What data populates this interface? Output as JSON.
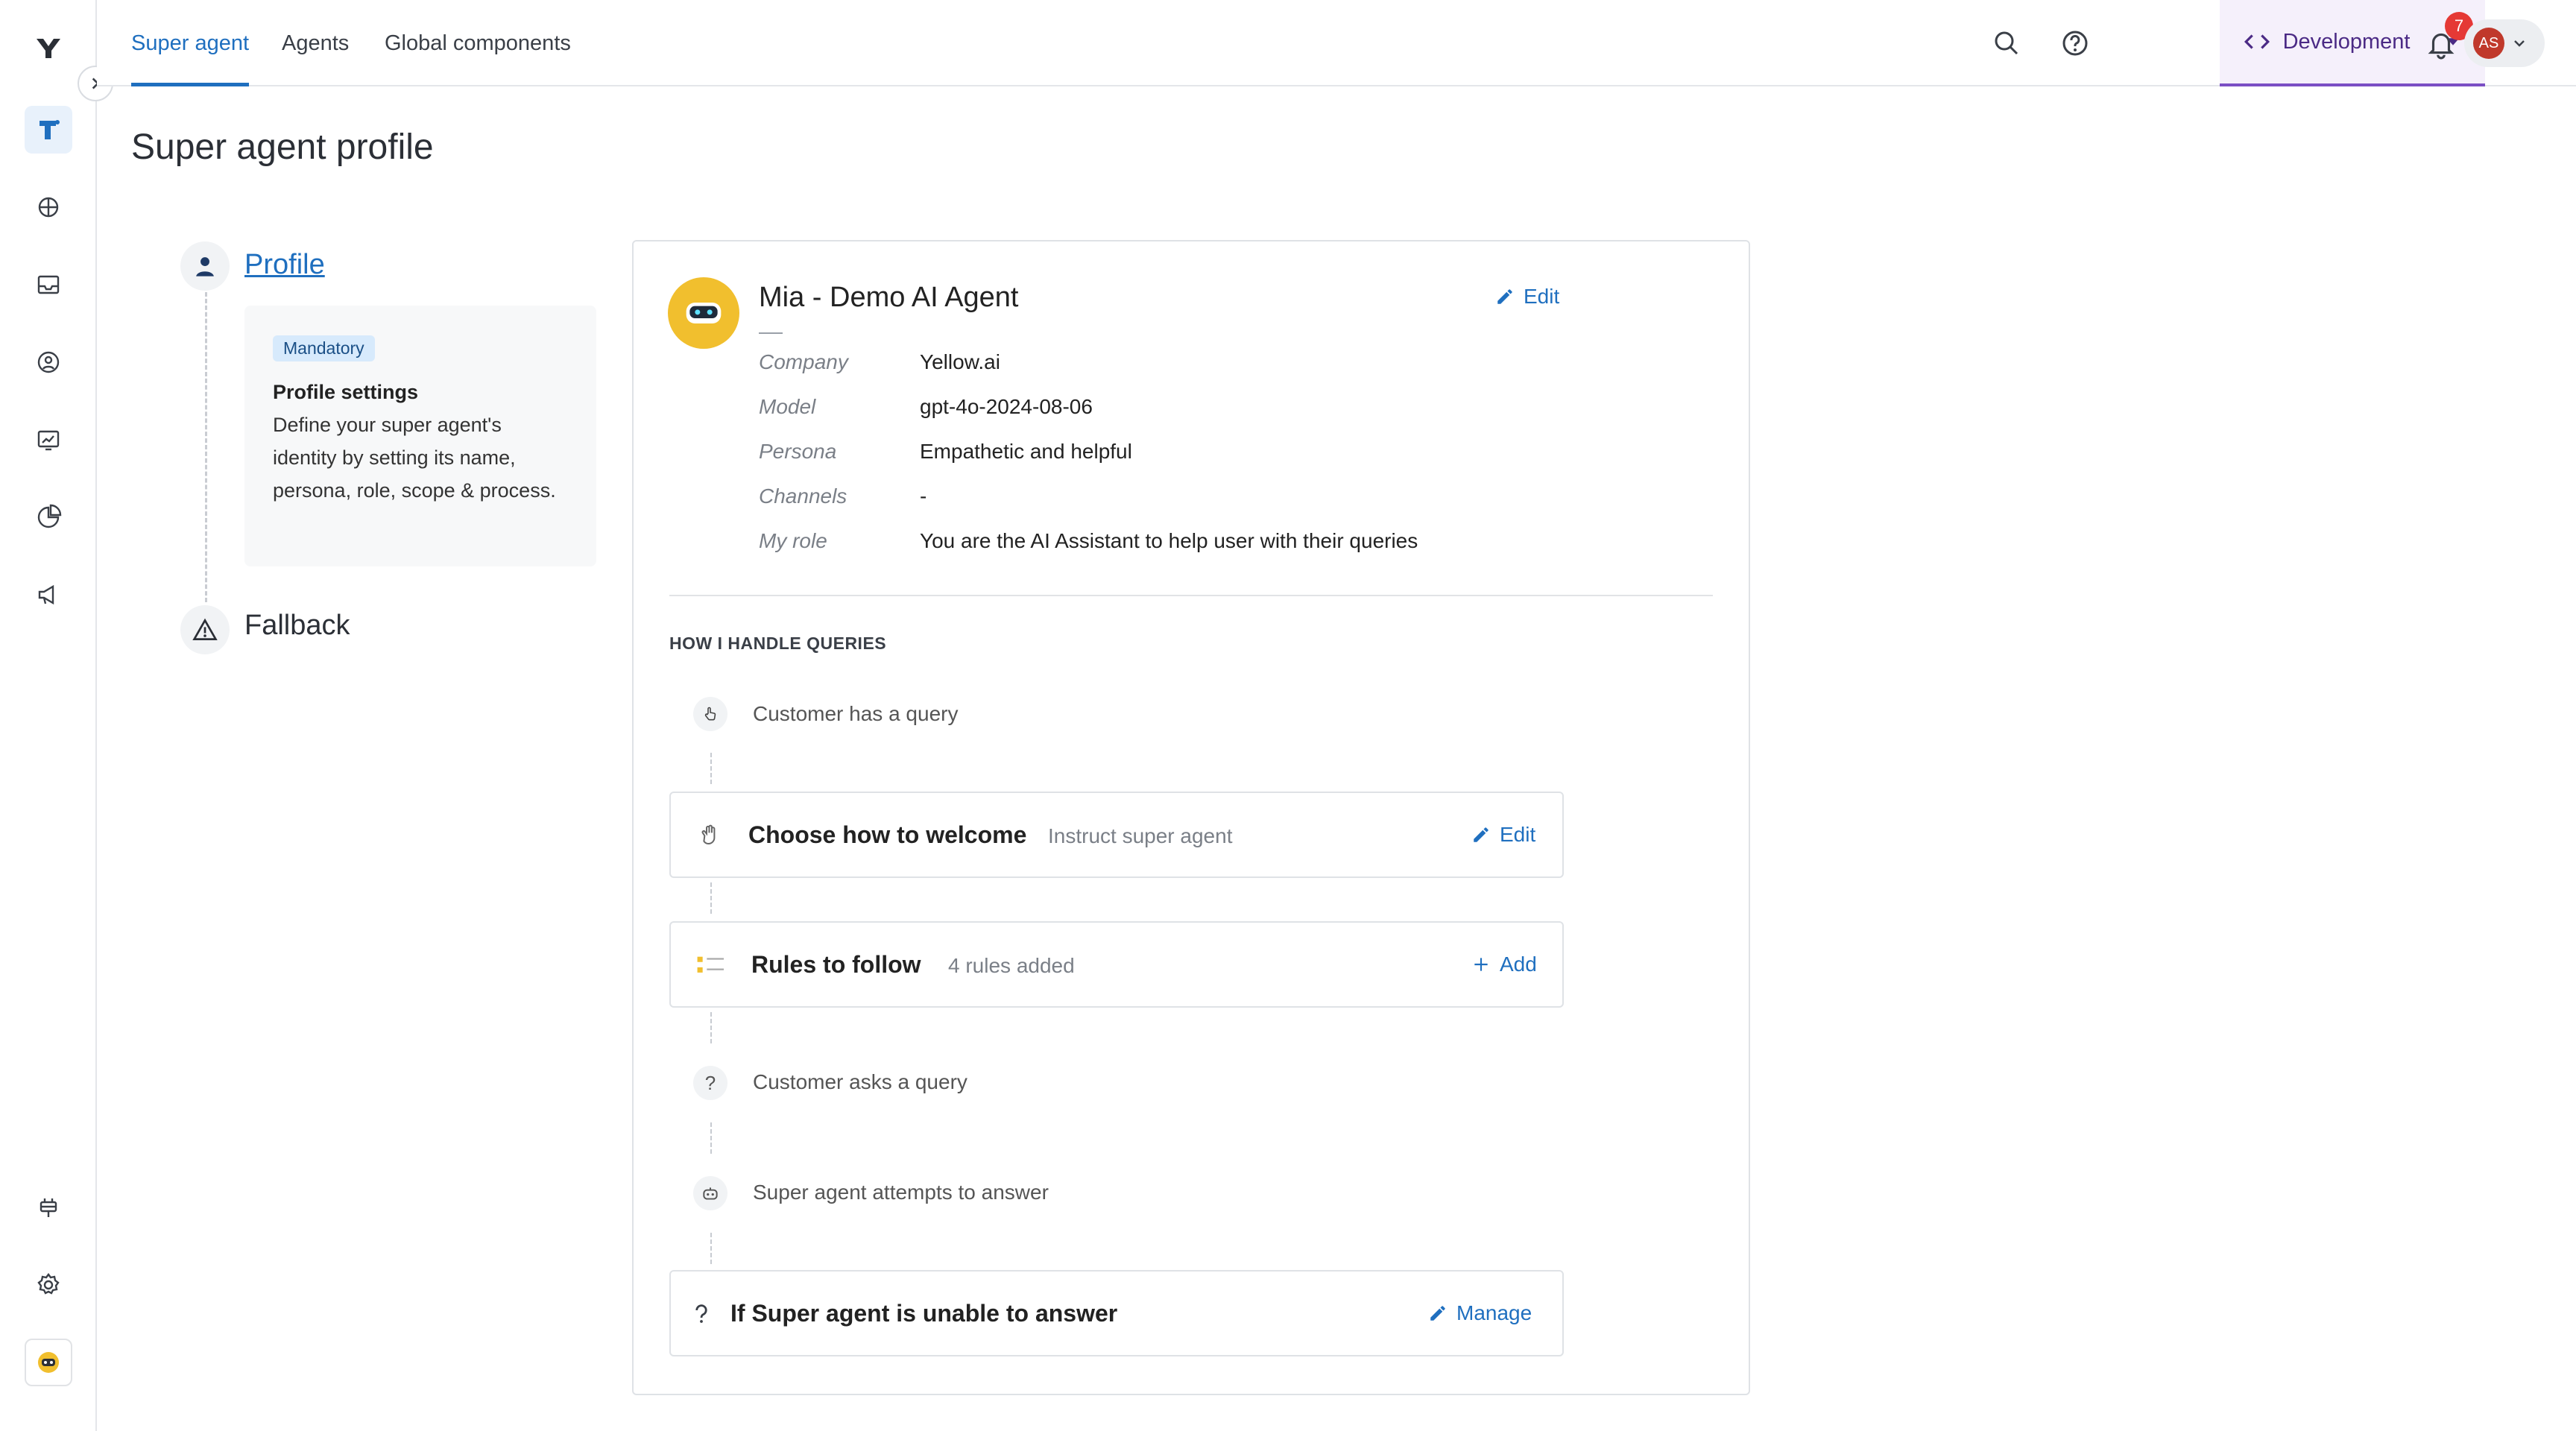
{
  "nav": {
    "tabs": [
      {
        "label": "Super agent"
      },
      {
        "label": "Agents"
      },
      {
        "label": "Global components"
      }
    ],
    "environment": "Development",
    "notification_count": "7",
    "user_initials": "AS"
  },
  "page": {
    "title": "Super agent profile"
  },
  "stepper": {
    "profile_label": "Profile",
    "mandatory_badge": "Mandatory",
    "settings_title": "Profile settings",
    "settings_desc": "Define your super agent's identity by setting its name, persona, role, scope & process.",
    "fallback_label": "Fallback"
  },
  "agent": {
    "name": "Mia - Demo AI Agent",
    "edit_label": "Edit",
    "fields": [
      {
        "key": "Company",
        "value": "Yellow.ai"
      },
      {
        "key": "Model",
        "value": "gpt-4o-2024-08-06"
      },
      {
        "key": "Persona",
        "value": "Empathetic and helpful"
      },
      {
        "key": "Channels",
        "value": "-"
      },
      {
        "key": "My role",
        "value": "You are the AI Assistant to help user with their queries"
      }
    ]
  },
  "queries": {
    "heading": "HOW I HANDLE QUERIES",
    "step1": "Customer has a query",
    "welcome": {
      "title": "Choose how to welcome",
      "sub": "Instruct super agent",
      "action": "Edit"
    },
    "rules": {
      "title": "Rules to follow",
      "sub": "4 rules added",
      "action": "Add"
    },
    "step2": "Customer asks a query",
    "step3": "Super agent attempts to answer",
    "fallback": {
      "title": "If Super agent is unable to answer",
      "action": "Manage"
    }
  },
  "colors": {
    "accent": "#1f6fbf",
    "environment": "#7b4fc4",
    "badge": "#e53935",
    "avatar": "#f1bf2e"
  }
}
